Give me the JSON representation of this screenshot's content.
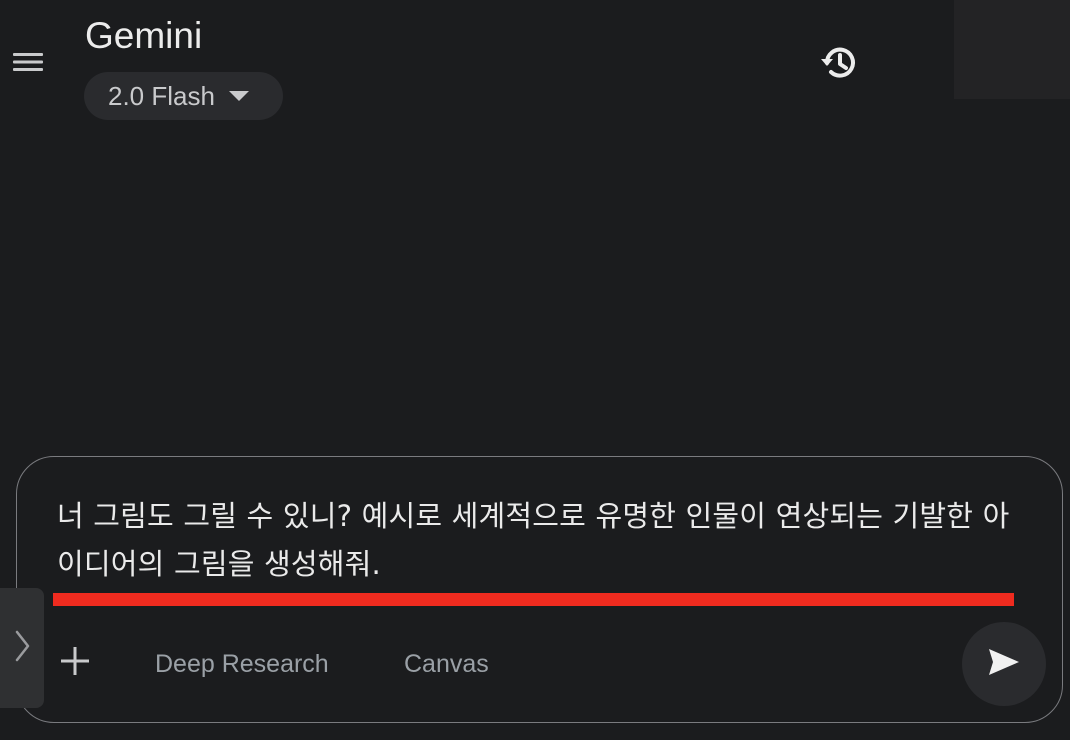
{
  "header": {
    "app_title": "Gemini",
    "model_selector": {
      "label": "2.0 Flash",
      "caret_icon": "caret-down-icon"
    },
    "menu_icon": "hamburger-menu-icon",
    "history_icon": "history-icon"
  },
  "composer": {
    "prompt_text": "너 그림도 그릴 수 있니? 예시로 세계적으로 유명한 인물이 연상되는 기발한 아이디어의 그림을 생성해줘.",
    "add_icon": "plus-icon",
    "chips": {
      "deep_research": "Deep Research",
      "canvas": "Canvas"
    },
    "send_icon": "send-icon",
    "side_handle_icon": "chevron-right-icon"
  },
  "colors": {
    "background": "#1b1c1e",
    "pill": "#2a2b2e",
    "underline_mark": "#ef2b1f",
    "composer_border": "#7a7b7f",
    "chip_text": "#9aa0a6"
  }
}
